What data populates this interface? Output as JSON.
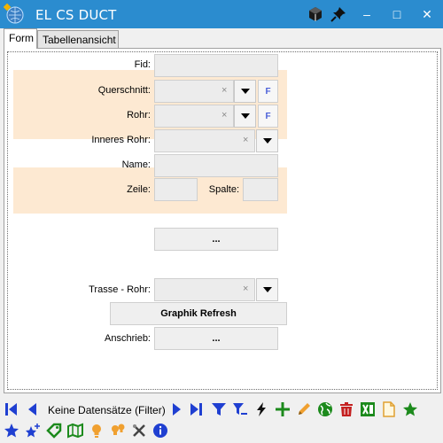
{
  "window": {
    "title": "EL CS DUCT",
    "minimize": "–",
    "maximize": "□",
    "close": "✕"
  },
  "tabs": [
    {
      "label": "Form",
      "active": true
    },
    {
      "label": "Tabellenansicht",
      "active": false
    }
  ],
  "form": {
    "fid": {
      "label": "Fid:",
      "value": ""
    },
    "querschnitt": {
      "label": "Querschnitt:",
      "value": "",
      "clear": "×",
      "f_label": "F"
    },
    "rohr": {
      "label": "Rohr:",
      "value": "",
      "clear": "×",
      "f_label": "F"
    },
    "inneres_rohr": {
      "label": "Inneres Rohr:",
      "value": "",
      "clear": "×"
    },
    "name": {
      "label": "Name:",
      "value": ""
    },
    "zeile": {
      "label": "Zeile:",
      "value": ""
    },
    "spalte": {
      "label": "Spalte:",
      "value": ""
    },
    "ellipsis_button": "...",
    "trasse_rohr": {
      "label": "Trasse - Rohr:",
      "value": "",
      "clear": "×"
    },
    "graphik_refresh": "Graphik Refresh",
    "anschrieb": {
      "label": "Anschrieb:",
      "button": "..."
    }
  },
  "toolbar": {
    "status": "Keine Datensätze (Filter)"
  },
  "colors": {
    "titlebar": "#2b8ccf",
    "band": "#fde9d2",
    "nav_blue": "#1f3fd1",
    "green": "#1c8a1c",
    "orange": "#f0a030",
    "red": "#c42020"
  }
}
